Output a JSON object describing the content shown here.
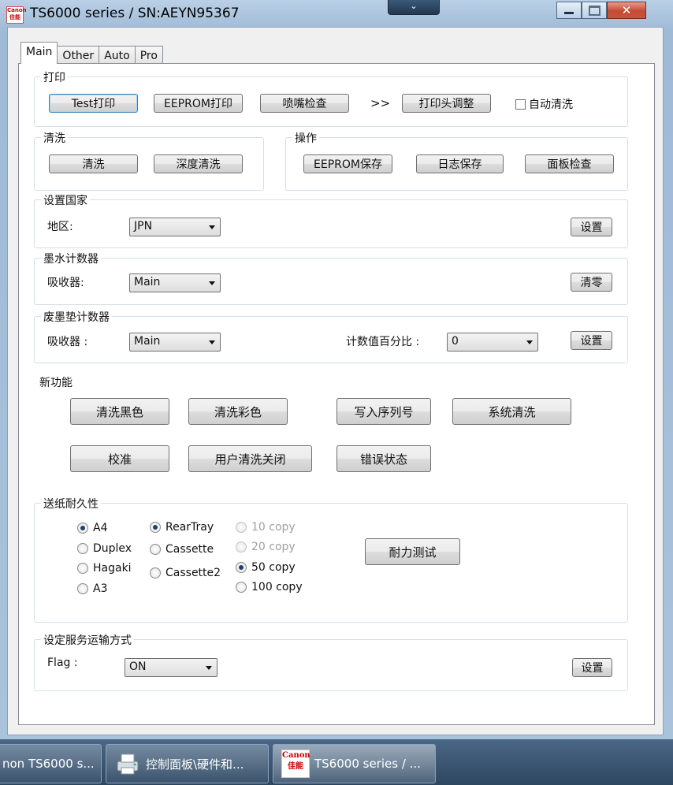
{
  "window": {
    "title": "TS6000 series / SN:AEYN95367",
    "icon_text": "Canon\n佳能"
  },
  "tabs": [
    "Main",
    "Other",
    "Auto",
    "Pro"
  ],
  "print_group": {
    "label": "打印",
    "test_print": "Test打印",
    "eeprom_print": "EEPROM打印",
    "nozzle_check": "喷嘴检查",
    "arrow": ">>",
    "head_align": "打印头调整",
    "auto_clean": "自动清洗"
  },
  "clean_group": {
    "label": "清洗",
    "clean": "清洗",
    "deep_clean": "深度清洗"
  },
  "ops_group": {
    "label": "操作",
    "eeprom_save": "EEPROM保存",
    "log_save": "日志保存",
    "panel_check": "面板检查"
  },
  "country_group": {
    "label": "设置国家",
    "region_label": "地区:",
    "region_value": "JPN",
    "set": "设置"
  },
  "ink_counter": {
    "label": "墨水计数器",
    "absorber_label": "吸收器:",
    "absorber_value": "Main",
    "reset": "清零"
  },
  "waste_counter": {
    "label": "废墨垫计数器",
    "absorber_label": "吸收器 :",
    "absorber_value": "Main",
    "percent_label": "计数值百分比 :",
    "percent_value": "0",
    "set": "设置"
  },
  "new_features": {
    "label": "新功能",
    "clean_black": "清洗黑色",
    "clean_color": "清洗彩色",
    "write_serial": "写入序列号",
    "system_clean": "系统清洗",
    "calibrate": "校准",
    "user_clean_off": "用户清洗关闭",
    "error_status": "错误状态"
  },
  "durability": {
    "label": "送纸耐久性",
    "paper": [
      {
        "label": "A4",
        "selected": true
      },
      {
        "label": "Duplex",
        "selected": false
      },
      {
        "label": "Hagaki",
        "selected": false
      },
      {
        "label": "A3",
        "selected": false
      }
    ],
    "tray": [
      {
        "label": "RearTray",
        "selected": true
      },
      {
        "label": "Cassette",
        "selected": false
      },
      {
        "label": "Cassette2",
        "selected": false
      }
    ],
    "copies": [
      {
        "label": "10 copy",
        "selected": false,
        "enabled": false
      },
      {
        "label": "20 copy",
        "selected": false,
        "enabled": false
      },
      {
        "label": "50 copy",
        "selected": true,
        "enabled": true
      },
      {
        "label": "100 copy",
        "selected": false,
        "enabled": true
      }
    ],
    "test_button": "耐力测试"
  },
  "shipping": {
    "label": "设定服务运输方式",
    "flag_label": "Flag :",
    "flag_value": "ON",
    "set": "设置"
  },
  "taskbar": {
    "items": [
      "non TS6000 s...",
      "控制面板\\硬件和...",
      "TS6000 series / ..."
    ],
    "canon_icon_text": "Canon\n佳能"
  }
}
